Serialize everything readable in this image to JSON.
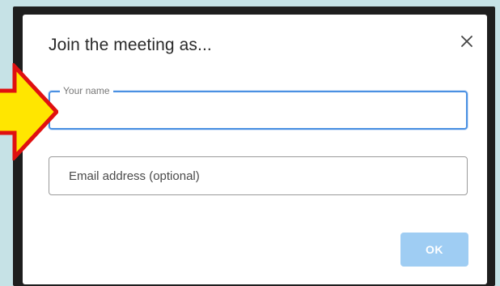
{
  "dialog": {
    "title": "Join the meeting as...",
    "close_icon": "close-icon"
  },
  "name_field": {
    "label": "Your name",
    "value": ""
  },
  "email_field": {
    "placeholder": "Email address (optional)",
    "value": ""
  },
  "ok_button": {
    "label": "OK"
  },
  "annotation": {
    "icon": "pointer-arrow-icon",
    "fill_color": "#ffe600",
    "stroke_color": "#e01010"
  },
  "colors": {
    "focus_border": "#4a90e2",
    "ok_button_bg": "#9fcdf3",
    "page_bg": "#c6e2e6"
  }
}
